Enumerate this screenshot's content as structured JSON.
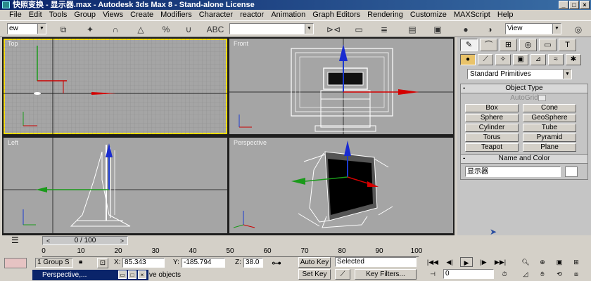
{
  "window": {
    "title": "快照变换 - 显示器.max - Autodesk 3ds Max 8 - Stand-alone License"
  },
  "menu": [
    "File",
    "Edit",
    "Tools",
    "Group",
    "Views",
    "Create",
    "Modifiers",
    "Character",
    "reactor",
    "Animation",
    "Graph Editors",
    "Rendering",
    "Customize",
    "MAXScript",
    "Help"
  ],
  "toolbar": {
    "selection_filter": "ew",
    "named_selection": "",
    "view_dropdown": "View"
  },
  "viewports": {
    "top_label": "Top",
    "front_label": "Front",
    "left_label": "Left",
    "perspective_label": "Perspective"
  },
  "command_panel": {
    "category": "Standard Primitives",
    "object_type": {
      "title": "Object Type",
      "autogrid_label": "AutoGrid",
      "buttons": [
        "Box",
        "Cone",
        "Sphere",
        "GeoSphere",
        "Cylinder",
        "Tube",
        "Torus",
        "Pyramid",
        "Teapot",
        "Plane"
      ]
    },
    "name_and_color": {
      "title": "Name and Color",
      "name_value": "显示器",
      "color": "#ffffff"
    }
  },
  "timeline": {
    "slider_text": "0 / 100",
    "ticks": [
      "0",
      "10",
      "20",
      "30",
      "40",
      "50",
      "60",
      "70",
      "80",
      "90",
      "100"
    ]
  },
  "status": {
    "selection_info": "1 Group S",
    "x_label": "X:",
    "x_value": "85.343",
    "y_label": "Y:",
    "y_value": "-185.794",
    "z_label": "Z:",
    "z_value": "38.0",
    "auto_key": "Auto Key",
    "set_key": "Set Key",
    "selected_dropdown": "Selected",
    "key_filters": "Key Filters...",
    "frame_value": "0",
    "prompt": "ve objects",
    "taskbar_title": "Perspective,..."
  },
  "colors": {
    "title_bar": "#0a246a",
    "viewport_bg": "#a5a5a5",
    "active_viewport_border": "#ffe000"
  }
}
